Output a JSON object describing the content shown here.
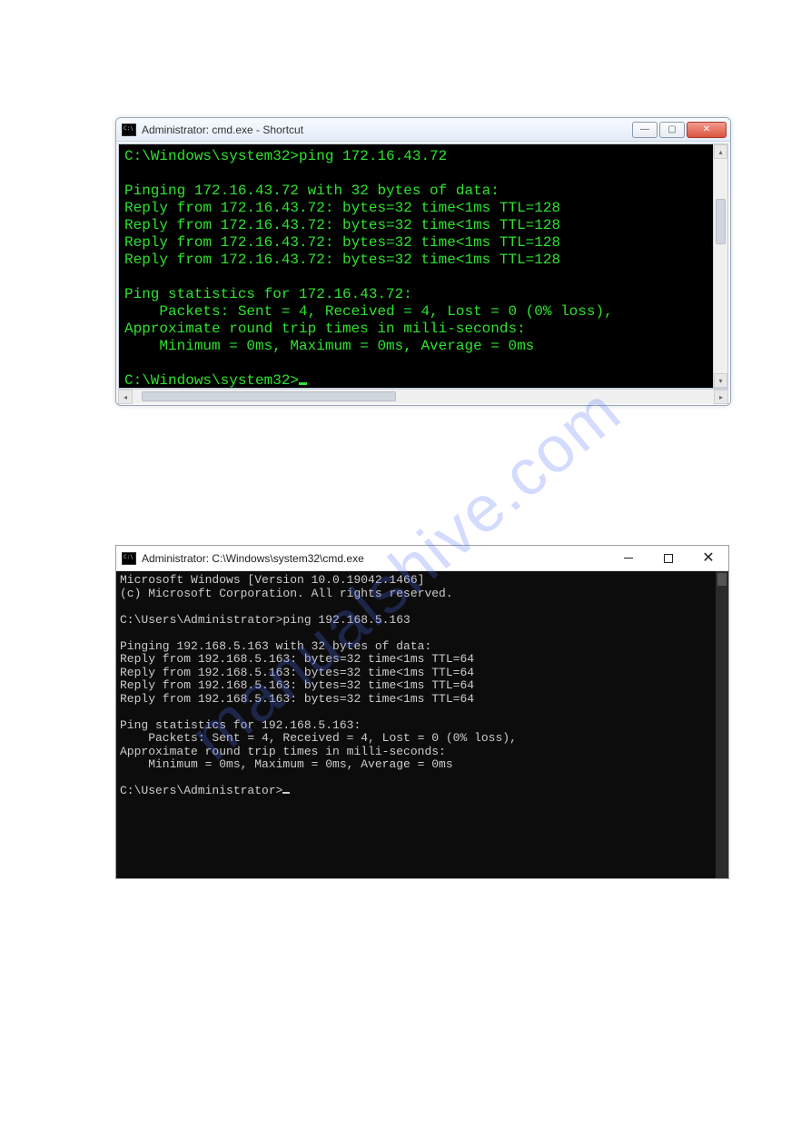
{
  "watermark": "manualshive.com",
  "window1": {
    "title": "Administrator: cmd.exe - Shortcut",
    "lines": {
      "l0": "C:\\Windows\\system32>ping 172.16.43.72",
      "l1": "",
      "l2": "Pinging 172.16.43.72 with 32 bytes of data:",
      "l3": "Reply from 172.16.43.72: bytes=32 time<1ms TTL=128",
      "l4": "Reply from 172.16.43.72: bytes=32 time<1ms TTL=128",
      "l5": "Reply from 172.16.43.72: bytes=32 time<1ms TTL=128",
      "l6": "Reply from 172.16.43.72: bytes=32 time<1ms TTL=128",
      "l7": "",
      "l8": "Ping statistics for 172.16.43.72:",
      "l9": "    Packets: Sent = 4, Received = 4, Lost = 0 (0% loss),",
      "l10": "Approximate round trip times in milli-seconds:",
      "l11": "    Minimum = 0ms, Maximum = 0ms, Average = 0ms",
      "l12": "",
      "prompt": "C:\\Windows\\system32>"
    }
  },
  "window2": {
    "title": "Administrator: C:\\Windows\\system32\\cmd.exe",
    "lines": {
      "l0": "Microsoft Windows [Version 10.0.19042.1466]",
      "l1": "(c) Microsoft Corporation. All rights reserved.",
      "l2": "",
      "l3": "C:\\Users\\Administrator>ping 192.168.5.163",
      "l4": "",
      "l5": "Pinging 192.168.5.163 with 32 bytes of data:",
      "l6": "Reply from 192.168.5.163: bytes=32 time<1ms TTL=64",
      "l7": "Reply from 192.168.5.163: bytes=32 time<1ms TTL=64",
      "l8": "Reply from 192.168.5.163: bytes=32 time<1ms TTL=64",
      "l9": "Reply from 192.168.5.163: bytes=32 time<1ms TTL=64",
      "l10": "",
      "l11": "Ping statistics for 192.168.5.163:",
      "l12": "    Packets: Sent = 4, Received = 4, Lost = 0 (0% loss),",
      "l13": "Approximate round trip times in milli-seconds:",
      "l14": "    Minimum = 0ms, Maximum = 0ms, Average = 0ms",
      "l15": "",
      "prompt": "C:\\Users\\Administrator>"
    }
  }
}
